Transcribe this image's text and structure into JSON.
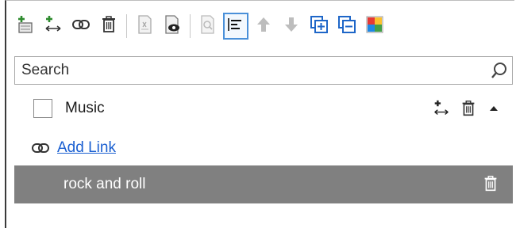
{
  "toolbar": {
    "buttons": [
      {
        "icon": "add-category-icon"
      },
      {
        "icon": "add-link-icon"
      },
      {
        "icon": "link-icon"
      },
      {
        "icon": "delete-icon"
      },
      {
        "icon": "document-icon"
      },
      {
        "icon": "preview-icon"
      },
      {
        "icon": "search-document-icon"
      },
      {
        "icon": "align-left-icon",
        "active": true
      },
      {
        "icon": "arrow-up-icon"
      },
      {
        "icon": "arrow-down-icon"
      },
      {
        "icon": "expand-all-icon"
      },
      {
        "icon": "collapse-all-icon"
      },
      {
        "icon": "color-palette-icon"
      }
    ]
  },
  "search": {
    "placeholder": "Search"
  },
  "category": {
    "label": "Music",
    "checked": false
  },
  "add_link": {
    "label": "Add Link"
  },
  "items": [
    {
      "label": "rock and roll",
      "selected": true
    }
  ],
  "colors": {
    "selected_row": "#808080",
    "link": "#1a5fd1",
    "toolbar_accent": "#1e66c8",
    "active_border": "#4a90d9"
  }
}
